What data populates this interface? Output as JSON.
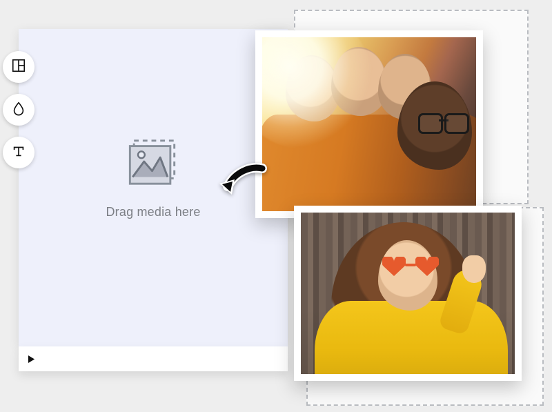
{
  "dropzone": {
    "label": "Drag media here"
  },
  "tools": {
    "layout_name": "layout",
    "background_name": "background",
    "text_name": "text"
  },
  "media": {
    "photo_a_alt": "group-photo",
    "photo_b_alt": "solo-photo"
  },
  "icons": {
    "image_placeholder": "image-placeholder-icon",
    "drag_arrow": "drag-arrow-icon",
    "play": "play-icon"
  }
}
